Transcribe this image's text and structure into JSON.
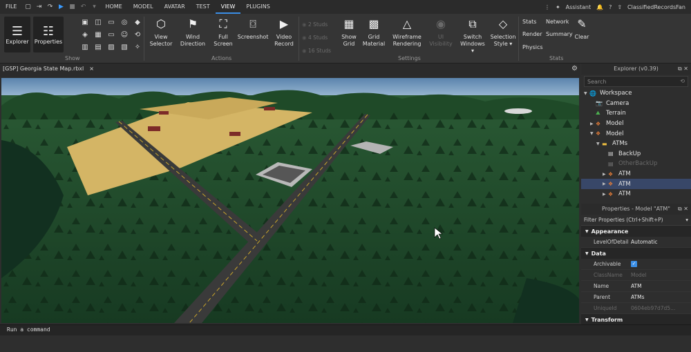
{
  "menubar": {
    "file": "FILE",
    "tabs": [
      "HOME",
      "MODEL",
      "AVATAR",
      "TEST",
      "VIEW",
      "PLUGINS"
    ],
    "active_tab": "VIEW",
    "assistant": "Assistant",
    "username": "ClassifiedRecordsFan"
  },
  "ribbon": {
    "show": {
      "explorer": "Explorer",
      "properties": "Properties",
      "label": "Show"
    },
    "actions": {
      "view_selector": [
        "View",
        "Selector"
      ],
      "wind_direction": [
        "Wind",
        "Direction"
      ],
      "full_screen": [
        "Full",
        "Screen"
      ],
      "screenshot": "Screenshot",
      "video_record": [
        "Video",
        "Record"
      ],
      "label": "Actions"
    },
    "settings": {
      "studs": [
        "2 Studs",
        "4 Studs",
        "16 Studs"
      ],
      "show_grid": [
        "Show",
        "Grid"
      ],
      "grid_material": [
        "Grid",
        "Material"
      ],
      "wireframe": [
        "Wireframe",
        "Rendering"
      ],
      "ui_visibility": "UI Visibility",
      "switch_windows": [
        "Switch",
        "Windows ▾"
      ],
      "selection_style": [
        "Selection",
        "Style ▾"
      ],
      "label": "Settings"
    },
    "stats": {
      "stats": "Stats",
      "network": "Network",
      "render": "Render",
      "summary": "Summary",
      "physics": "Physics",
      "clear": "Clear",
      "label": "Stats"
    }
  },
  "document_tab": {
    "title": "[GSP] Georgia State Map.rbxl",
    "close": "×"
  },
  "explorer": {
    "title": "Explorer (v0.39)",
    "search_placeholder": "Search",
    "items": [
      {
        "label": "Workspace",
        "indent": 0,
        "arrow": "▼",
        "icon": "🌐",
        "color": "#4a8fd6"
      },
      {
        "label": "Camera",
        "indent": 1,
        "arrow": "",
        "icon": "📷",
        "color": "#cccccc"
      },
      {
        "label": "Terrain",
        "indent": 1,
        "arrow": "",
        "icon": "⛰",
        "color": "#4caf50"
      },
      {
        "label": "Model",
        "indent": 1,
        "arrow": "▶",
        "icon": "❖",
        "color": "#e07b39"
      },
      {
        "label": "Model",
        "indent": 1,
        "arrow": "▼",
        "icon": "❖",
        "color": "#e07b39"
      },
      {
        "label": "ATMs",
        "indent": 2,
        "arrow": "▼",
        "icon": "▬",
        "color": "#f0c040"
      },
      {
        "label": "BackUp",
        "indent": 3,
        "arrow": "",
        "icon": "▤",
        "color": "#cccccc"
      },
      {
        "label": "OtherBackUp",
        "indent": 3,
        "arrow": "",
        "icon": "▤",
        "color": "#777777",
        "dim": true
      },
      {
        "label": "ATM",
        "indent": 3,
        "arrow": "▶",
        "icon": "❖",
        "color": "#e07b39"
      },
      {
        "label": "ATM",
        "indent": 3,
        "arrow": "▶",
        "icon": "❖",
        "color": "#e07b39",
        "selected": true
      },
      {
        "label": "ATM",
        "indent": 3,
        "arrow": "▶",
        "icon": "❖",
        "color": "#e07b39"
      }
    ]
  },
  "properties": {
    "title": "Properties - Model \"ATM\"",
    "filter_placeholder": "Filter Properties (Ctrl+Shift+P)",
    "sections": [
      {
        "name": "Appearance",
        "rows": [
          {
            "key": "LevelOfDetail",
            "value": "Automatic"
          }
        ]
      },
      {
        "name": "Data",
        "rows": [
          {
            "key": "Archivable",
            "value": "✓",
            "checkbox": true
          },
          {
            "key": "ClassName",
            "value": "Model",
            "dim": true
          },
          {
            "key": "Name",
            "value": "ATM"
          },
          {
            "key": "Parent",
            "value": "ATMs"
          },
          {
            "key": "UniqueId",
            "value": "0604eb97d7d5...",
            "dim": true
          }
        ]
      },
      {
        "name": "Transform",
        "rows": []
      }
    ]
  },
  "command_bar": {
    "placeholder": "Run a command"
  }
}
